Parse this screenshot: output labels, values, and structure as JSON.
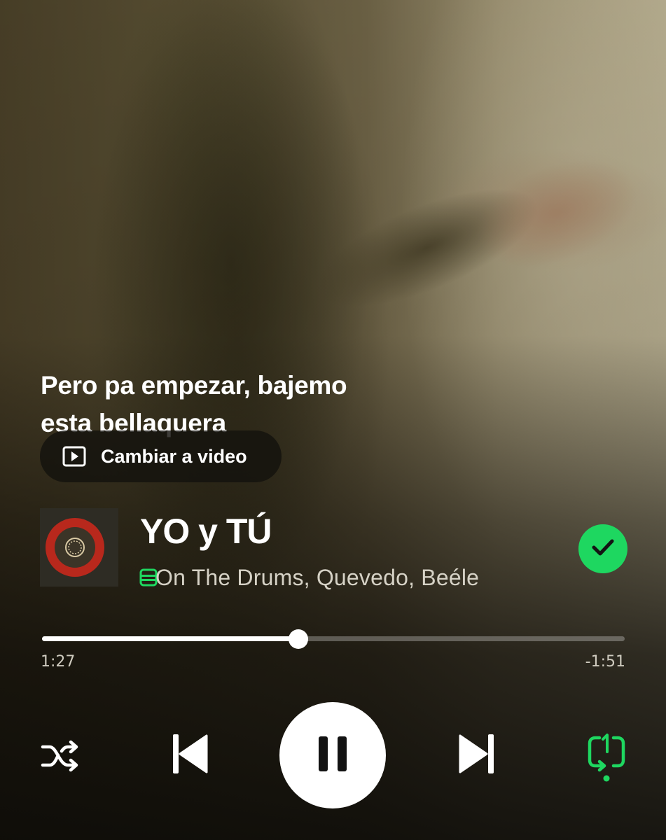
{
  "lyrics": {
    "lines": [
      "Pero pa empezar, bajemo",
      "esta bellaquera"
    ]
  },
  "switch_video": {
    "label": "Cambiar a video",
    "icon": "play-square-icon"
  },
  "track": {
    "title": "YO y TÚ",
    "artists": "On The Drums, Quevedo, Beéle",
    "saved": true
  },
  "playback": {
    "elapsed": "1:27",
    "remaining": "-1:51",
    "progress": 0.44,
    "is_playing": true,
    "repeat_mode": "one"
  },
  "icons": {
    "shuffle": "shuffle-icon",
    "previous": "skip-previous-icon",
    "pause": "pause-icon",
    "next": "skip-next-icon",
    "repeat": "repeat-one-icon",
    "saved": "check-icon",
    "lyrics_badge": "lyrics-icon"
  },
  "colors": {
    "accent": "#1ed760",
    "text_primary": "#ffffff",
    "text_secondary": "#d6d2c6",
    "cover_ring": "#b8281c"
  }
}
